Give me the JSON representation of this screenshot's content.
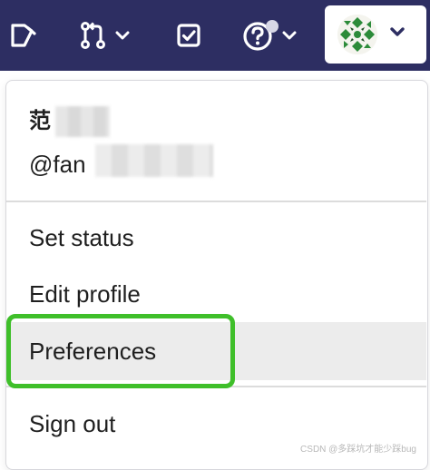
{
  "topbar": {
    "background_color": "#2d2e62",
    "icons": {
      "snippet": "snippet-icon",
      "merge_requests": "merge-request-icon",
      "todos": "todo-icon",
      "help": "help-icon",
      "chevron": "chevron-down-icon"
    }
  },
  "user_menu": {
    "name": "范",
    "handle": "@fan",
    "items": [
      {
        "label": "Set status"
      },
      {
        "label": "Edit profile"
      },
      {
        "label": "Preferences",
        "highlighted": true
      },
      {
        "label": "Sign out"
      }
    ]
  },
  "annotation": {
    "color": "#3fbf2a",
    "target": "Preferences"
  },
  "watermark": "CSDN @多踩坑才能少踩bug"
}
